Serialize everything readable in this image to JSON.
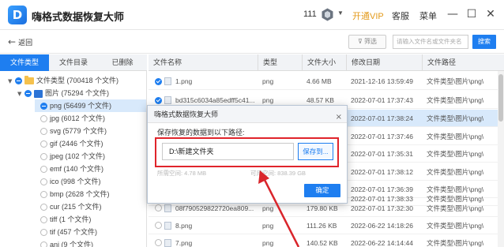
{
  "app": {
    "logo_letter": "D",
    "title": "嗨格式数据恢复大师",
    "count": "111",
    "vip": "开通VIP",
    "service": "客服",
    "menu": "菜单",
    "minimize": "—",
    "maximize": "☐",
    "close": "✕"
  },
  "toolbar": {
    "back_label": "返回",
    "filter_label": "筛选",
    "search_placeholder": "请输入文件名或文件夹名",
    "search_button": "搜索"
  },
  "left_tabs": [
    "文件类型",
    "文件目录",
    "已删除"
  ],
  "tree": [
    {
      "label": "文件类型 (700418 个文件)",
      "state": "partial",
      "icon": "folder-icon"
    },
    {
      "label": "图片 (75294 个文件)",
      "state": "partial",
      "icon": "image-folder-icon"
    },
    {
      "label": "png (56499 个文件)",
      "state": "partial",
      "selected": true
    },
    {
      "label": "jpg (6012 个文件)",
      "state": "empty"
    },
    {
      "label": "svg (5779 个文件)",
      "state": "empty"
    },
    {
      "label": "gif (2446 个文件)",
      "state": "empty"
    },
    {
      "label": "jpeg (102 个文件)",
      "state": "empty"
    },
    {
      "label": "emf (140 个文件)",
      "state": "empty"
    },
    {
      "label": "ico (998 个文件)",
      "state": "empty"
    },
    {
      "label": "bmp (2628 个文件)",
      "state": "empty"
    },
    {
      "label": "cur (215 个文件)",
      "state": "empty"
    },
    {
      "label": "tiff (1 个文件)",
      "state": "empty"
    },
    {
      "label": "tif (457 个文件)",
      "state": "empty"
    },
    {
      "label": "ani (9 个文件)",
      "state": "empty"
    }
  ],
  "columns": [
    "文件名称",
    "类型",
    "文件大小",
    "修改日期",
    "文件路径"
  ],
  "rows": [
    {
      "name": "1.png",
      "type": "png",
      "size": "4.66 MB",
      "date": "2021-12-16 13:59:49",
      "path": "文件类型\\图片\\png\\",
      "checked": true
    },
    {
      "name": "bd315c6034a85edff5c41...",
      "type": "png",
      "size": "48.57 KB",
      "date": "2022-07-01 17:37:43",
      "path": "文件类型\\图片\\png\\",
      "checked": true
    },
    {
      "name": "",
      "type": "",
      "size": "",
      "date": "2022-07-01 17:38:24",
      "path": "文件类型\\图片\\png\\",
      "checked": false,
      "selected": true
    },
    {
      "name": "",
      "type": "",
      "size": "",
      "date": "2022-07-01 17:37:46",
      "path": "文件类型\\图片\\png\\",
      "checked": false
    },
    {
      "name": "",
      "type": "",
      "size": "",
      "date": "2022-07-01 17:35:31",
      "path": "文件类型\\图片\\png\\",
      "checked": false
    },
    {
      "name": "",
      "type": "",
      "size": "",
      "date": "2022-07-01 17:38:12",
      "path": "文件类型\\图片\\png\\",
      "checked": false
    },
    {
      "name": "",
      "type": "",
      "size": "",
      "date": "2022-07-01 17:36:39",
      "path": "文件类型\\图片\\png\\",
      "checked": false
    },
    {
      "name": "",
      "type": "",
      "size": "",
      "date": "2022-07-01 17:38:33",
      "path": "文件类型\\图片\\png\\",
      "checked": false
    },
    {
      "name": "08f790529822720ea809...",
      "type": "png",
      "size": "179.80 KB",
      "date": "2022-07-01 17:32:30",
      "path": "文件类型\\图片\\png\\",
      "checked": false
    },
    {
      "name": "8.png",
      "type": "png",
      "size": "111.26 KB",
      "date": "2022-06-22 14:18:26",
      "path": "文件类型\\图片\\png\\",
      "checked": false
    },
    {
      "name": "7.png",
      "type": "png",
      "size": "140.52 KB",
      "date": "2022-06-22 14:14:44",
      "path": "文件类型\\图片\\png\\",
      "checked": false
    }
  ],
  "dialog": {
    "title": "嗨格式数据恢复大师",
    "close": "×",
    "label": "保存恢复的数据到以下路径:",
    "path_value": "D:\\新建文件夹",
    "save_to": "保存到...",
    "faint_left": "所需空间: 4.78 MB",
    "faint_right": "可用空间: 838.39 GB",
    "ok": "确定"
  },
  "colors": {
    "accent": "#1e7ef0",
    "highlight": "#e0242b",
    "vip": "#e39a1b"
  }
}
